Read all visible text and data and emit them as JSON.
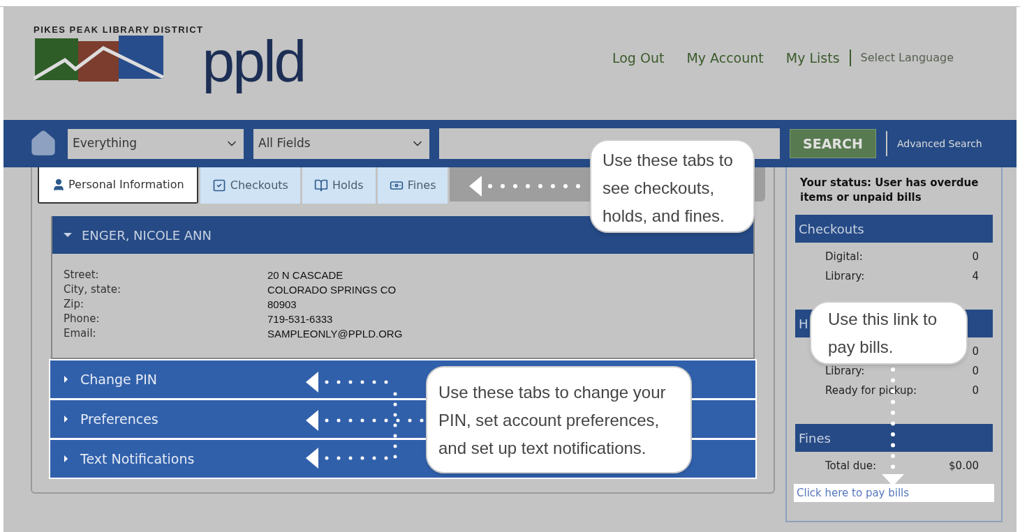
{
  "header": {
    "logo": {
      "tagline": "PIKES PEAK LIBRARY DISTRICT",
      "wordmark": "ppld"
    },
    "nav_links": [
      "Log Out",
      "My Account",
      "My Lists"
    ],
    "language": "Select Language"
  },
  "search_bar": {
    "scope": "Everything",
    "field": "All Fields",
    "button": "SEARCH",
    "advanced_link": "Advanced Search"
  },
  "tabs": [
    {
      "label": "Personal Information",
      "kind": "user",
      "selected": true
    },
    {
      "label": "Checkouts",
      "kind": "check",
      "selected": false
    },
    {
      "label": "Holds",
      "kind": "book",
      "selected": false
    },
    {
      "label": "Fines",
      "kind": "money",
      "selected": false
    }
  ],
  "patron": {
    "name": "ENGER, NICOLE ANN",
    "expanded": true,
    "fields": [
      {
        "label": "Street:",
        "value": "20 N CASCADE"
      },
      {
        "label": "City, state:",
        "value": "COLORADO SPRINGS CO"
      },
      {
        "label": "Zip:",
        "value": "80903"
      },
      {
        "label": "Phone:",
        "value": "719-531-6333"
      },
      {
        "label": "Email:",
        "value": "SAMPLEONLY@PPLD.ORG"
      }
    ]
  },
  "sections": [
    {
      "label": "Change PIN",
      "expanded": false
    },
    {
      "label": "Preferences",
      "expanded": false
    },
    {
      "label": "Text Notifications",
      "expanded": false
    }
  ],
  "sidebar": {
    "status": "Your status: User has overdue items or unpaid bills",
    "groups": [
      {
        "title": "Checkouts",
        "rows": [
          {
            "label": "Digital:",
            "value": "0"
          },
          {
            "label": "Library:",
            "value": "4"
          }
        ]
      },
      {
        "title": "H",
        "rows": [
          {
            "value": "0"
          },
          {
            "label": "Library:",
            "value": "0"
          },
          {
            "label": "Ready for pickup:",
            "value": "0"
          }
        ]
      },
      {
        "title": "Fines",
        "rows": [
          {
            "label": "Total due:",
            "value": "$0.00"
          }
        ]
      }
    ],
    "pay_link": "Click here to pay bills"
  },
  "callouts": [
    {
      "text": "Use these tabs to see checkouts, holds, and fines."
    },
    {
      "text": "Use these tabs to change your PIN, set account preferences, and set up text notifications."
    },
    {
      "text": "Use this link to pay bills."
    }
  ]
}
